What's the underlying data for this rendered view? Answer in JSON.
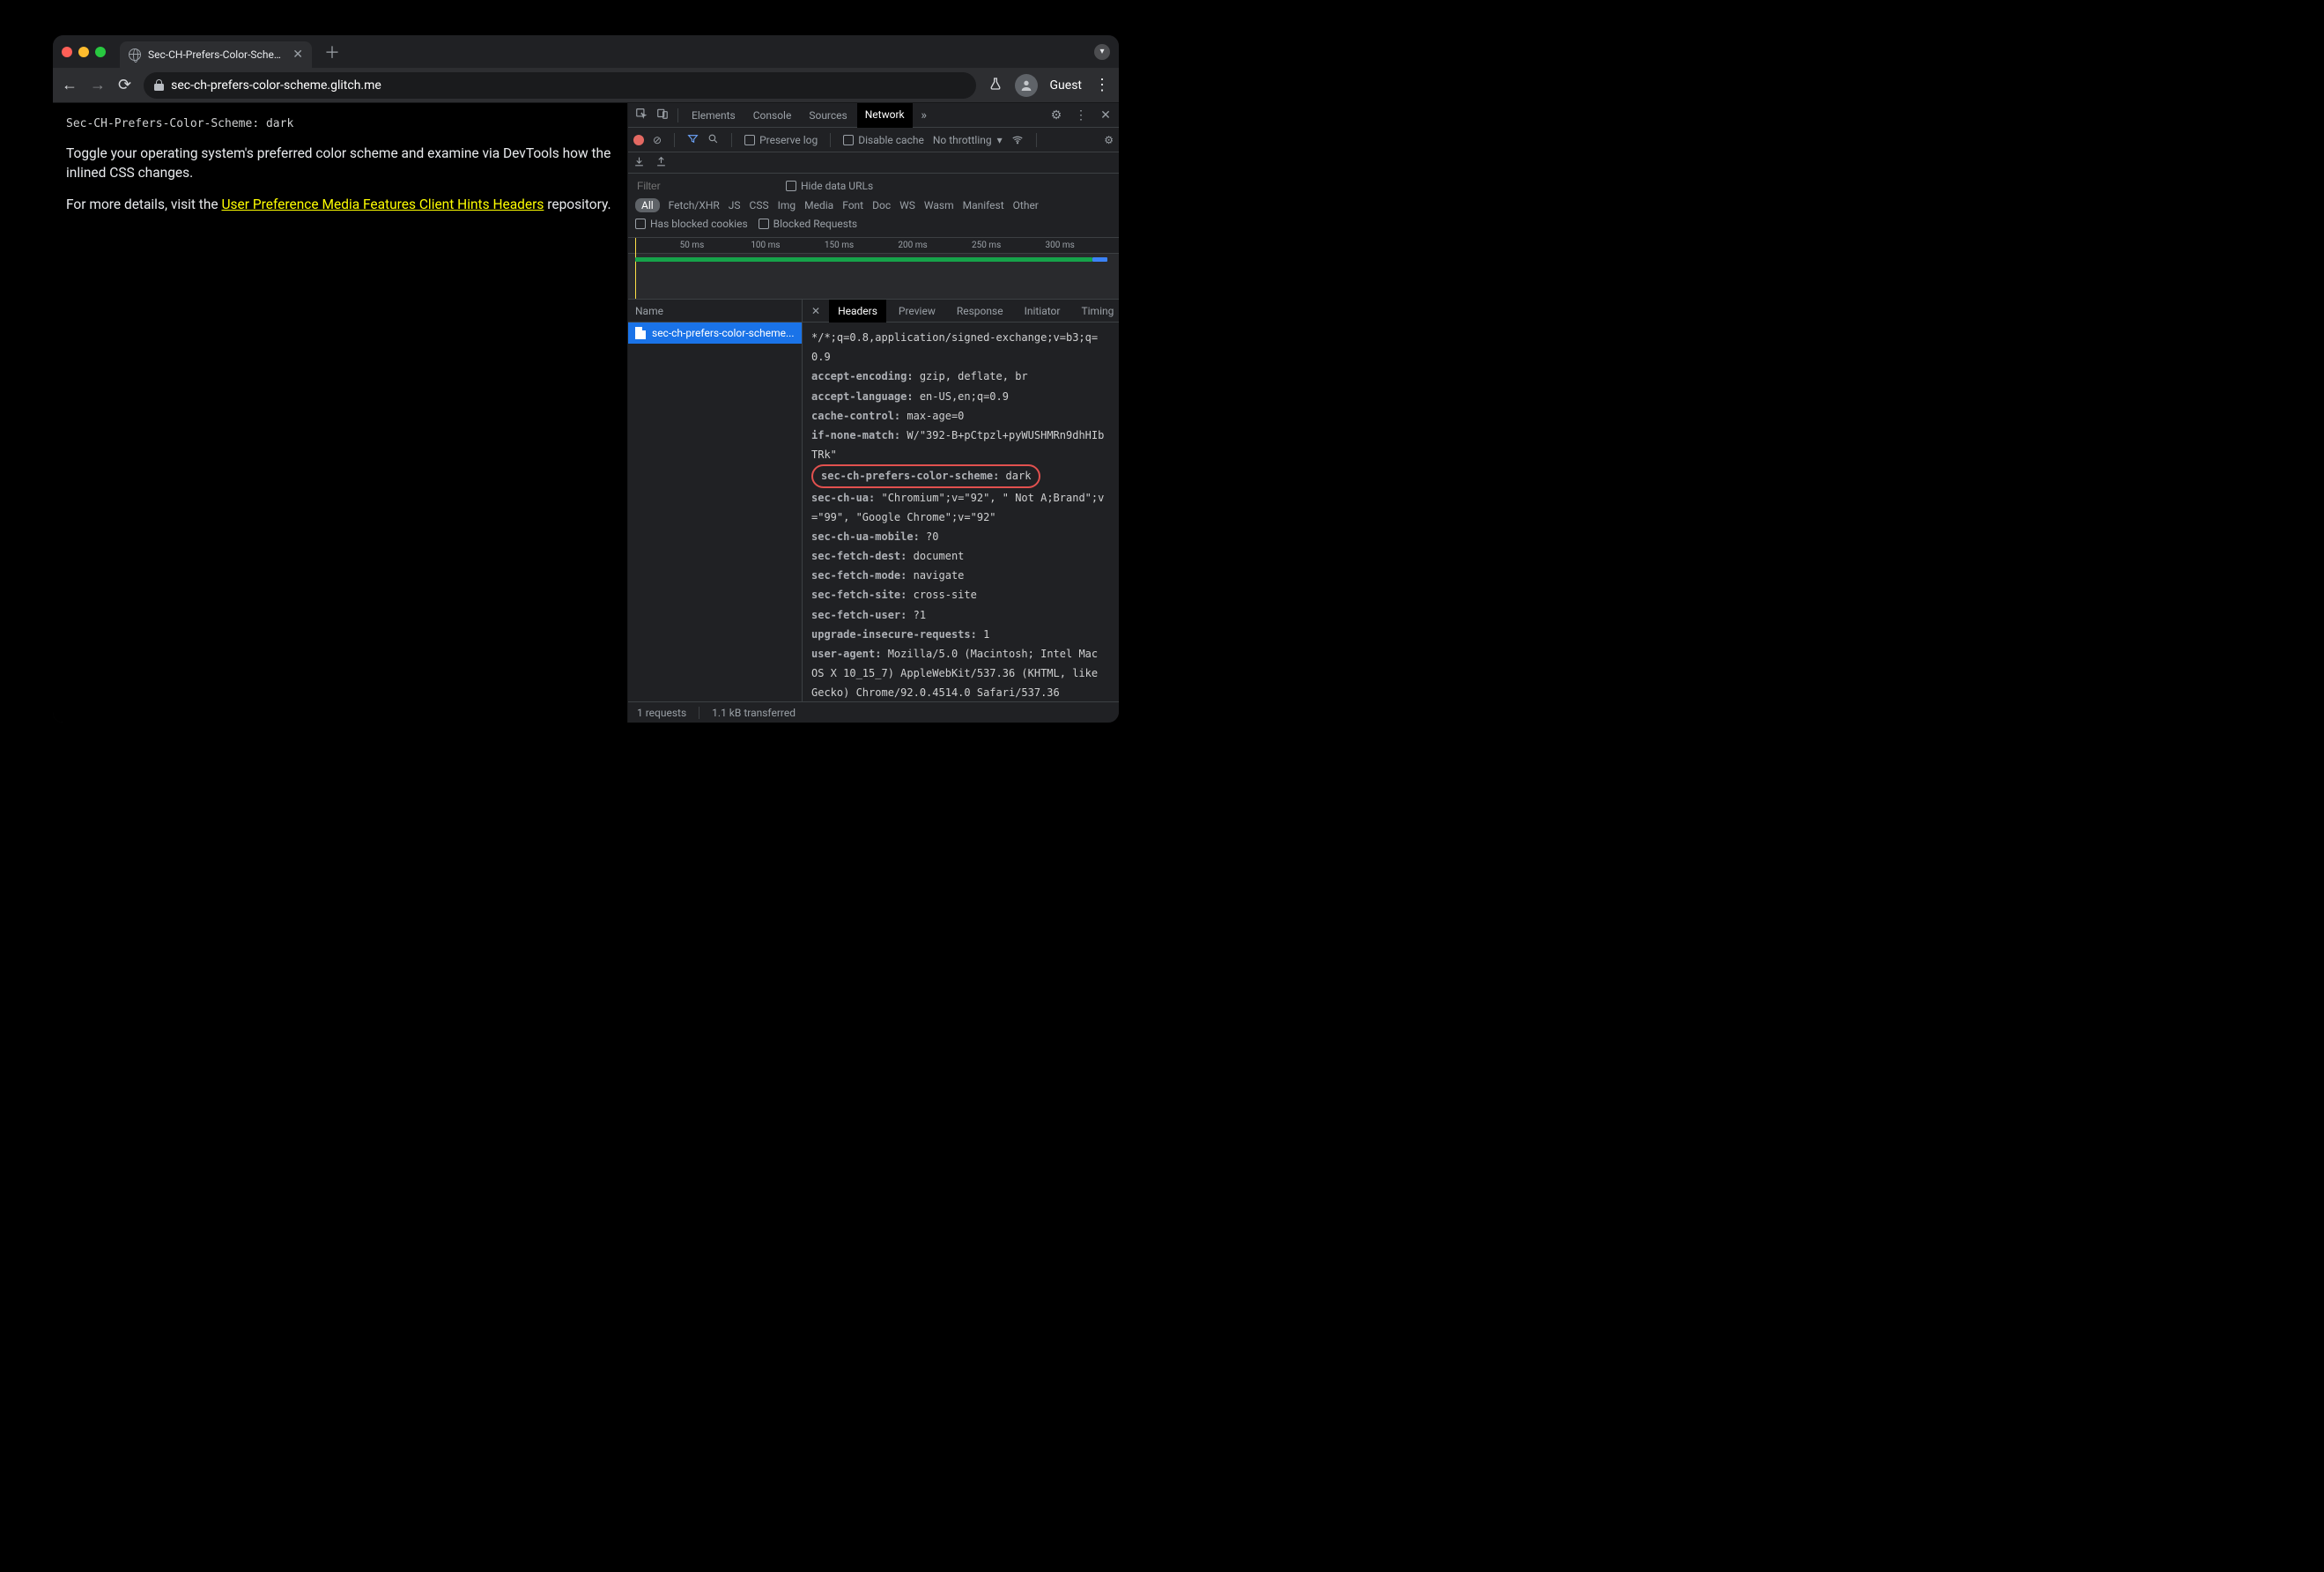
{
  "browser": {
    "tab_title": "Sec-CH-Prefers-Color-Scheme",
    "url_host": "sec-ch-prefers-color-scheme.glitch.me",
    "profile": "Guest"
  },
  "page": {
    "header_line": "Sec-CH-Prefers-Color-Scheme: dark",
    "p1": "Toggle your operating system's preferred color scheme and examine via DevTools how the inlined CSS changes.",
    "p2_pre": "For more details, visit the ",
    "p2_link": "User Preference Media Features Client Hints Headers",
    "p2_post": " repository."
  },
  "devtools": {
    "tabs": [
      "Elements",
      "Console",
      "Sources",
      "Network"
    ],
    "active_tab": "Network",
    "toolbar": {
      "preserve": "Preserve log",
      "disable_cache": "Disable cache",
      "throttle": "No throttling"
    },
    "filter": {
      "placeholder": "Filter",
      "hide_data_urls": "Hide data URLs",
      "types": [
        "All",
        "Fetch/XHR",
        "JS",
        "CSS",
        "Img",
        "Media",
        "Font",
        "Doc",
        "WS",
        "Wasm",
        "Manifest",
        "Other"
      ],
      "active_type": "All",
      "blocked_cookies": "Has blocked cookies",
      "blocked_req": "Blocked Requests"
    },
    "timeline": {
      "ticks": [
        "50 ms",
        "100 ms",
        "150 ms",
        "200 ms",
        "250 ms",
        "300 ms"
      ]
    },
    "requests": {
      "col": "Name",
      "rows": [
        "sec-ch-prefers-color-scheme..."
      ]
    },
    "detail_tabs": [
      "Headers",
      "Preview",
      "Response",
      "Initiator",
      "Timing"
    ],
    "detail_active": "Headers",
    "headers": [
      {
        "k": "",
        "v": "*/*;q=0.8,application/signed-exchange;v=b3;q=0.9",
        "wrap": true
      },
      {
        "k": "accept-encoding:",
        "v": " gzip, deflate, br"
      },
      {
        "k": "accept-language:",
        "v": " en-US,en;q=0.9"
      },
      {
        "k": "cache-control:",
        "v": " max-age=0"
      },
      {
        "k": "if-none-match:",
        "v": " W/\"392-B+pCtpzl+pyWUSHMRn9dhHIbTRk\""
      },
      {
        "k": "sec-ch-prefers-color-scheme:",
        "v": " dark",
        "highlight": true
      },
      {
        "k": "sec-ch-ua:",
        "v": " \"Chromium\";v=\"92\", \" Not A;Brand\";v=\"99\", \"Google Chrome\";v=\"92\""
      },
      {
        "k": "sec-ch-ua-mobile:",
        "v": " ?0"
      },
      {
        "k": "sec-fetch-dest:",
        "v": " document"
      },
      {
        "k": "sec-fetch-mode:",
        "v": " navigate"
      },
      {
        "k": "sec-fetch-site:",
        "v": " cross-site"
      },
      {
        "k": "sec-fetch-user:",
        "v": " ?1"
      },
      {
        "k": "upgrade-insecure-requests:",
        "v": " 1"
      },
      {
        "k": "user-agent:",
        "v": " Mozilla/5.0 (Macintosh; Intel Mac OS X 10_15_7) AppleWebKit/537.36 (KHTML, like Gecko) Chrome/92.0.4514.0 Safari/537.36"
      }
    ],
    "status": {
      "requests": "1 requests",
      "transferred": "1.1 kB transferred"
    }
  }
}
